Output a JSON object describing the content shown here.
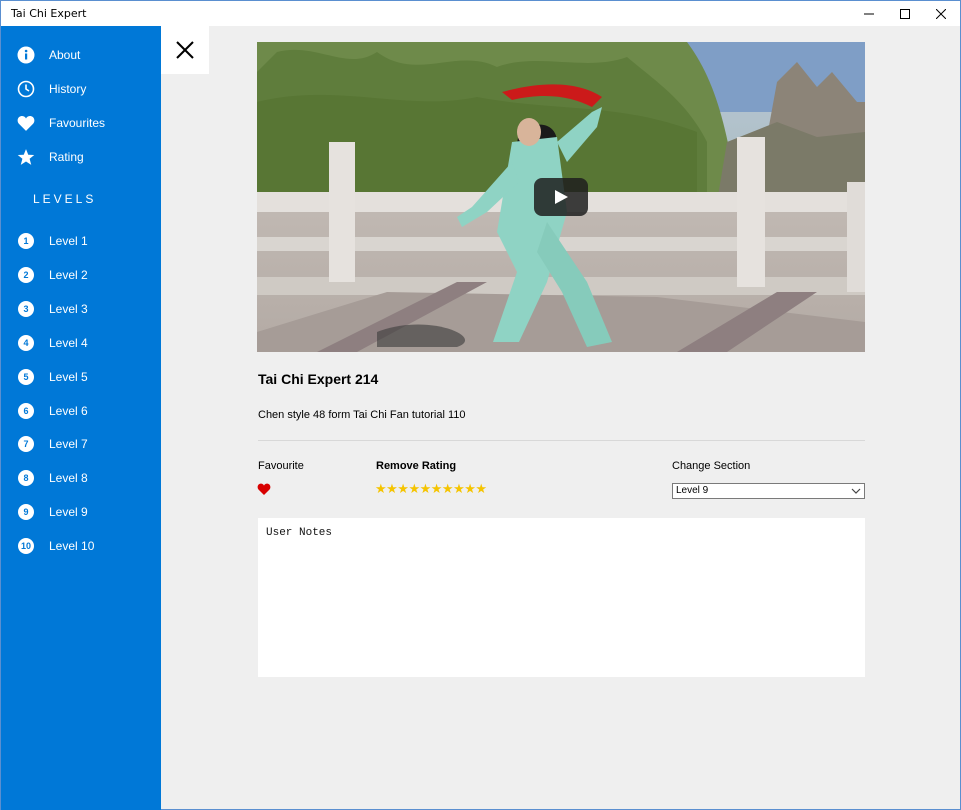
{
  "window": {
    "title": "Tai Chi Expert"
  },
  "sidebar": {
    "items": [
      {
        "label": "About",
        "icon": "info-icon"
      },
      {
        "label": "History",
        "icon": "clock-icon"
      },
      {
        "label": "Favourites",
        "icon": "heart-icon"
      },
      {
        "label": "Rating",
        "icon": "star-icon"
      }
    ],
    "levels_header": "LEVELS",
    "levels": [
      {
        "num": "1",
        "label": "Level 1"
      },
      {
        "num": "2",
        "label": "Level 2"
      },
      {
        "num": "3",
        "label": "Level 3"
      },
      {
        "num": "4",
        "label": "Level 4"
      },
      {
        "num": "5",
        "label": "Level 5"
      },
      {
        "num": "6",
        "label": "Level 6"
      },
      {
        "num": "7",
        "label": "Level 7"
      },
      {
        "num": "8",
        "label": "Level 8"
      },
      {
        "num": "9",
        "label": "Level 9"
      },
      {
        "num": "10",
        "label": "Level 10"
      }
    ]
  },
  "detail": {
    "title": "Tai Chi Expert 214",
    "description": "Chen style 48 form Tai Chi Fan tutorial 110",
    "favourite_label": "Favourite",
    "rating_label": "Remove Rating",
    "stars": "★★★★★★★★★★",
    "rating_value": 10,
    "section_label": "Change Section",
    "section_selected": "Level 9",
    "notes_placeholder": "User Notes"
  },
  "colors": {
    "accent": "#0078d7",
    "heart": "#d80000",
    "star": "#f5c400",
    "background": "#efefef"
  }
}
